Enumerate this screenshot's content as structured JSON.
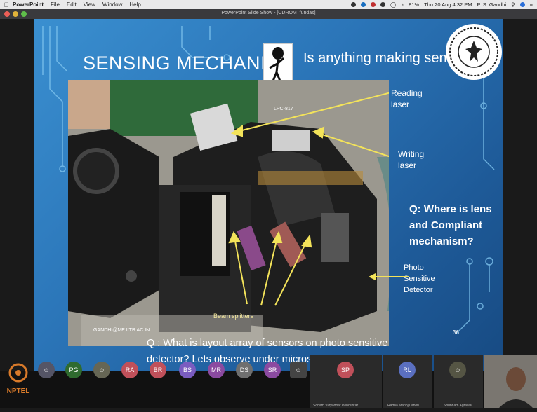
{
  "menubar": {
    "app": "PowerPoint",
    "items": [
      "File",
      "Edit",
      "View",
      "Window",
      "Help"
    ],
    "battery": "81%",
    "datetime": "Thu 20 Aug 4:32 PM",
    "user": "P. S. Gandhi"
  },
  "window": {
    "title": "PowerPoint Slide Show - [CDROM_fundas]"
  },
  "slide": {
    "title": "SENSING MECHANISM",
    "subtitle": "Is anything making sense??",
    "labels": {
      "reading": "Reading laser",
      "writing": "Writing laser",
      "photo": "Photo Sensitive Detector",
      "beam": "Beam splitters",
      "chip": "LPC-817"
    },
    "question_lens": "Q: Where is lens and Compliant mechanism?",
    "question_sensors": "Q : What is layout array of sensors on photo sensitive detector? Lets observe under microscope!",
    "email": "GANDHI@ME.IITB.AC.IN",
    "page_number": "36"
  },
  "participants": [
    {
      "initials": "PG",
      "color": "#2f6b2f"
    },
    {
      "initials": "RA",
      "color": "#c0505a"
    },
    {
      "initials": "BR",
      "color": "#c0505a"
    },
    {
      "initials": "BS",
      "color": "#7a5cc0"
    },
    {
      "initials": "MR",
      "color": "#8b4aa0"
    },
    {
      "initials": "DS",
      "color": "#6f6f6f"
    },
    {
      "initials": "SR",
      "color": "#8b4aa0"
    },
    {
      "initials": "SP",
      "color": "#c0505a"
    },
    {
      "initials": "RL",
      "color": "#5a6fc0"
    }
  ],
  "participant_names": {
    "sp": "Soham Vidyadhar Pendurkar",
    "rl": "Radha Manoj Lahoti",
    "sa": "Shubham Agrawal"
  },
  "nptel": "NPTEL",
  "colors": {
    "slide_bg": "#2b75b8",
    "menubar": "#e9e9ea",
    "zoom_bg": "#111111"
  }
}
